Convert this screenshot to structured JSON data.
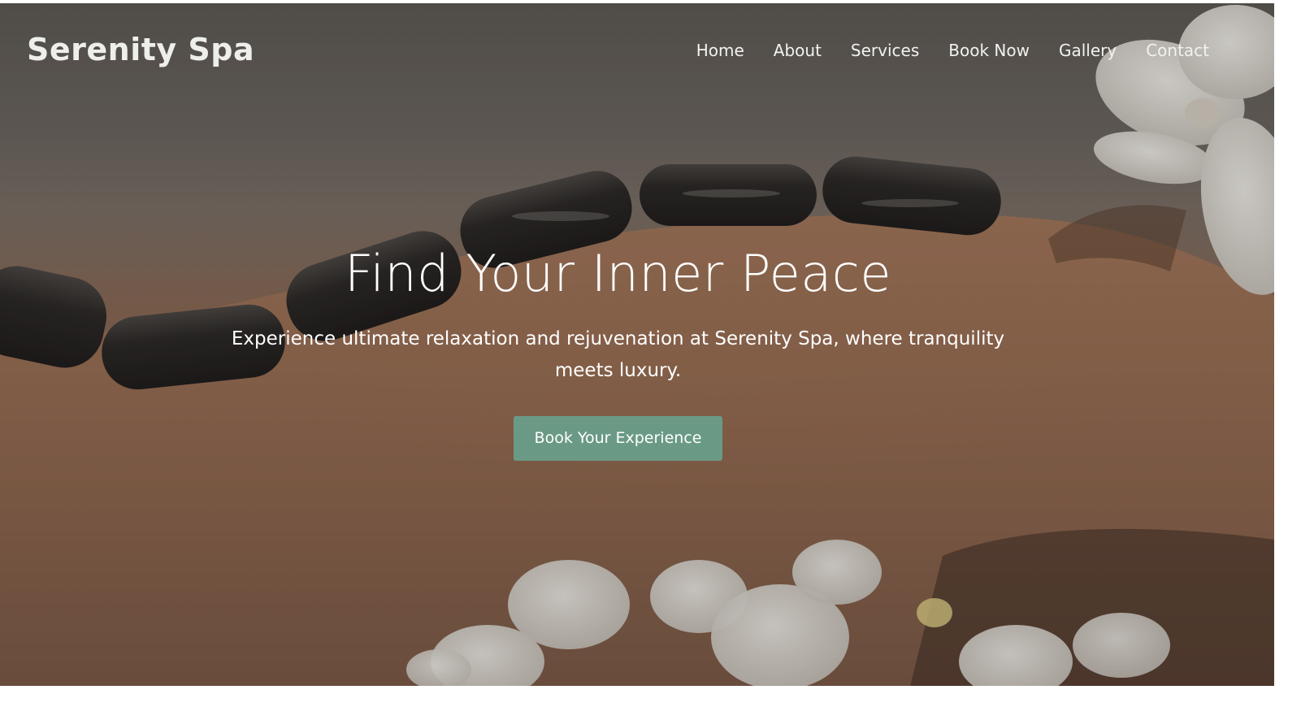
{
  "brand": {
    "name": "Serenity Spa"
  },
  "nav": {
    "items": [
      {
        "label": "Home"
      },
      {
        "label": "About"
      },
      {
        "label": "Services"
      },
      {
        "label": "Book Now"
      },
      {
        "label": "Gallery"
      },
      {
        "label": "Contact"
      }
    ]
  },
  "hero": {
    "headline": "Find Your Inner Peace",
    "subtitle": "Experience ultimate relaxation and rejuvenation at Serenity Spa, where tranquility meets luxury.",
    "cta_label": "Book Your Experience",
    "image_subject": "hot-stone-massage-photo"
  },
  "colors": {
    "accent": "#6a9a85",
    "text_on_image": "#ffffff",
    "brand_text": "#eeeeea"
  }
}
